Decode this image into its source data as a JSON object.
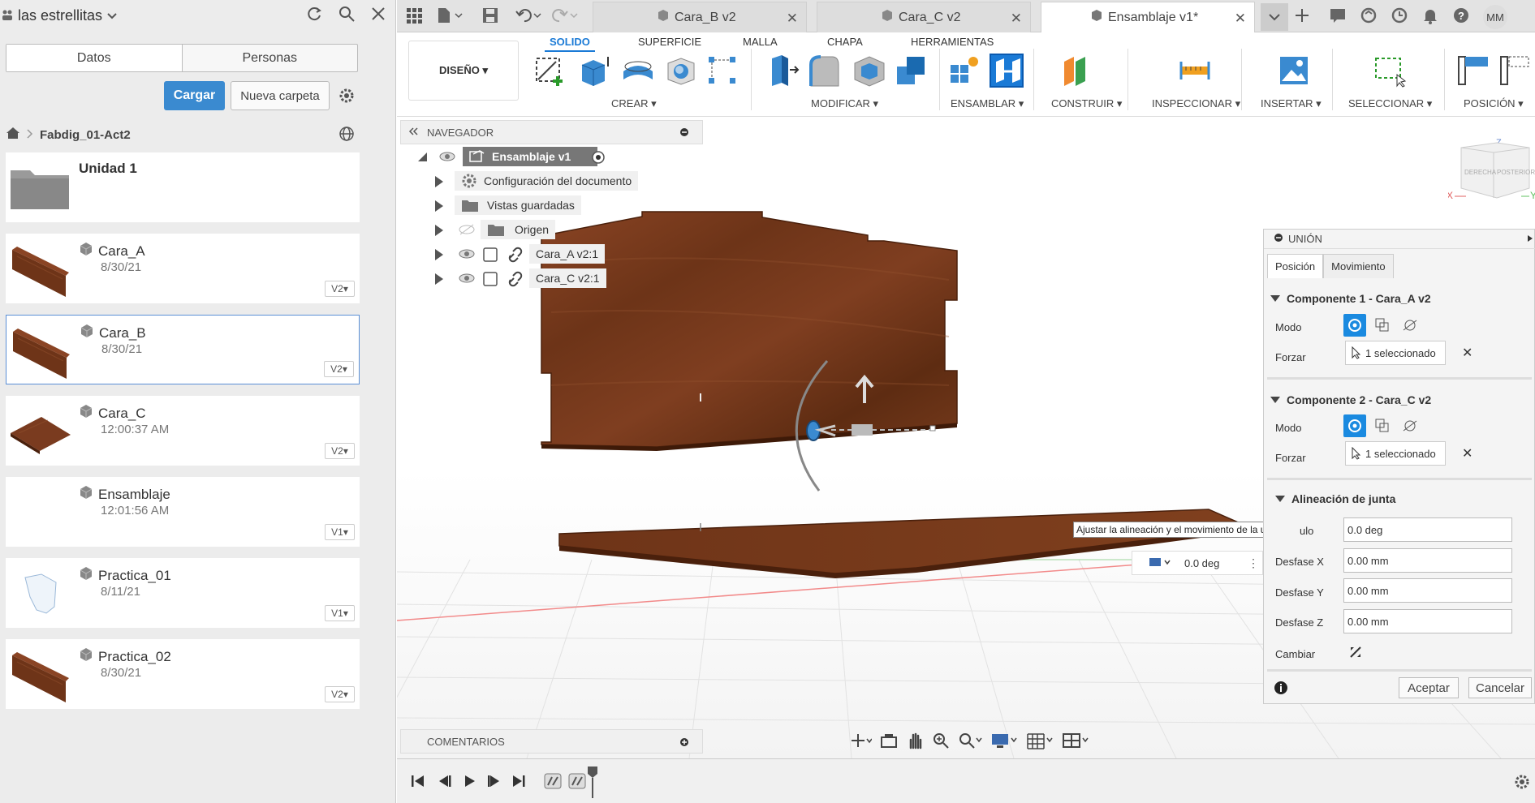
{
  "left_panel": {
    "team_name": "las estrellitas",
    "tabs": [
      "Datos",
      "Personas"
    ],
    "upload_label": "Cargar",
    "new_folder_label": "Nueva carpeta",
    "breadcrumb": "Fabdig_01-Act2",
    "items": [
      {
        "name": "Unidad 1",
        "date": "",
        "version": "",
        "type": "folder"
      },
      {
        "name": "Cara_A",
        "date": "8/30/21",
        "version": "V2▾",
        "type": "wood-panel"
      },
      {
        "name": "Cara_B",
        "date": "8/30/21",
        "version": "V2▾",
        "type": "wood-panel",
        "selected": true
      },
      {
        "name": "Cara_C",
        "date": "12:00:37 AM",
        "version": "V2▾",
        "type": "wood-flat"
      },
      {
        "name": "Ensamblaje",
        "date": "12:01:56 AM",
        "version": "V1▾",
        "type": "empty"
      },
      {
        "name": "Practica_01",
        "date": "8/11/21",
        "version": "V1▾",
        "type": "outline"
      },
      {
        "name": "Practica_02",
        "date": "8/30/21",
        "version": "V2▾",
        "type": "wood-panel"
      }
    ]
  },
  "doc_tabs": [
    {
      "label": "Cara_B v2",
      "active": false
    },
    {
      "label": "Cara_C v2",
      "active": false
    },
    {
      "label": "Ensamblaje v1*",
      "active": true
    }
  ],
  "user_initials": "MM",
  "toolbar": {
    "workspace": "DISEÑO ▾",
    "tabs": [
      "SOLIDO",
      "SUPERFICIE",
      "MALLA",
      "CHAPA",
      "HERRAMIENTAS"
    ],
    "groups": [
      "CREAR ▾",
      "MODIFICAR ▾",
      "ENSAMBLAR ▾",
      "CONSTRUIR ▾",
      "INSPECCIONAR ▾",
      "INSERTAR ▾",
      "SELECCIONAR ▾",
      "POSICIÓN ▾"
    ]
  },
  "navigator": {
    "title": "NAVEGADOR",
    "root": "Ensamblaje v1",
    "nodes": [
      "Configuración del documento",
      "Vistas guardadas",
      "Origen",
      "Cara_A v2:1",
      "Cara_C v2:1"
    ]
  },
  "viewcube": {
    "faces": [
      "DERECHA",
      "POSTERIOR"
    ],
    "axes": [
      "Z",
      "X",
      "Y"
    ]
  },
  "union_panel": {
    "title": "UNIÓN",
    "tabs": [
      "Posición",
      "Movimiento"
    ],
    "component1": "Componente 1 - Cara_A v2",
    "component2": "Componente 2 - Cara_C v2",
    "mode_label": "Modo",
    "force_label": "Forzar",
    "selected_text": "1 seleccionado",
    "alignment_title": "Alineación de junta",
    "angle_label": "ulo",
    "angle_value": "0.0 deg",
    "offset_x_label": "Desfase X",
    "offset_x_value": "0.00 mm",
    "offset_y_label": "Desfase Y",
    "offset_y_value": "0.00 mm",
    "offset_z_label": "Desfase Z",
    "offset_z_value": "0.00 mm",
    "flip_label": "Cambiar",
    "ok_label": "Aceptar",
    "cancel_label": "Cancelar"
  },
  "tooltip": "Ajustar la alineación y el movimiento de la unión",
  "angle_manipulator_value": "0.0 deg",
  "comments_title": "COMENTARIOS",
  "colors": {
    "accent": "#1a7ad6",
    "wood": "#7a3b1f",
    "upload": "#3a8ad0"
  }
}
